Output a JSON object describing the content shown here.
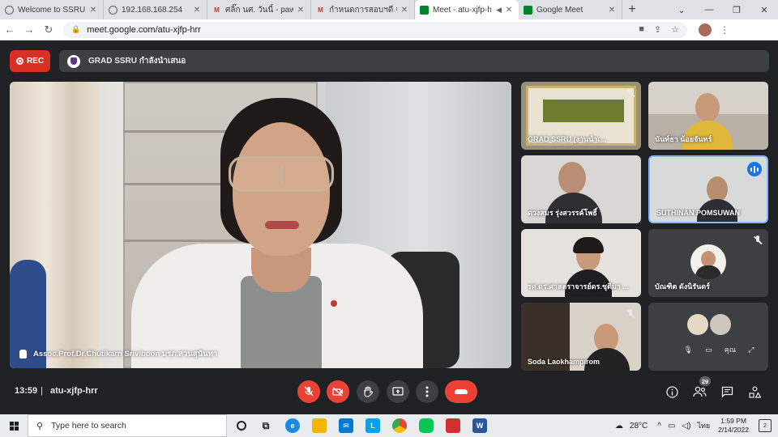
{
  "browser": {
    "tabs": [
      {
        "title": "Welcome to SSRU S",
        "favicon": "globe-icon",
        "active": false
      },
      {
        "title": "192.168.168.254",
        "favicon": "globe-icon",
        "active": false
      },
      {
        "title": "ศลิ๊ก นศ. วันนี้ - paweena",
        "favicon": "gmail-icon",
        "active": false
      },
      {
        "title": "กำหนดการสอบฯดี จ.ช่า",
        "favicon": "gmail-icon",
        "active": false
      },
      {
        "title": "Meet - atu-xjfp-h",
        "favicon": "meet-icon",
        "active": true
      },
      {
        "title": "Google Meet",
        "favicon": "meet-icon",
        "active": false
      }
    ],
    "url": "meet.google.com/atu-xjfp-hrr"
  },
  "meet": {
    "rec_label": "REC",
    "meeting_title": "GRAD SSRU กำลังนำเสนอ",
    "main_speaker": "Assoc.Prof.Dr.Chutikarn Sriviboon มรภ.สวนสุนันทา",
    "tiles": [
      {
        "name": "GRAD SSRU (งานนำเ...",
        "muted": true
      },
      {
        "name": "นันท์ธา น้อยจันทร์",
        "muted": false
      },
      {
        "name": "ดวงสมร รุ่งสวรรค์โพธิ์",
        "muted": false
      },
      {
        "name": "SUTHINAN POMSUWAN",
        "muted": false,
        "speaking": true
      },
      {
        "name": "รศ.ดร.ศาสตราจารย์ดร.ชุติมา ...",
        "muted": false
      },
      {
        "name": "บัณฑิต ดังนิรันดร์",
        "muted": true
      },
      {
        "name": "Soda Laokhampirom",
        "muted": true
      },
      {
        "name": "คุณ",
        "muted": true
      }
    ],
    "time": "13:59",
    "separator": "|",
    "meeting_code": "atu-xjfp-hrr",
    "participant_count": "29"
  },
  "taskbar": {
    "search_placeholder": "Type here to search",
    "temperature": "28°C",
    "language": "ไทย",
    "time": "1:59 PM",
    "date": "2/14/2022",
    "notifications": "2"
  },
  "colors": {
    "accent_red": "#ea4335",
    "rec_red": "#d93025",
    "meet_dark": "#202124",
    "tile_grey": "#3c4043",
    "active_border": "#8ab4f8"
  }
}
